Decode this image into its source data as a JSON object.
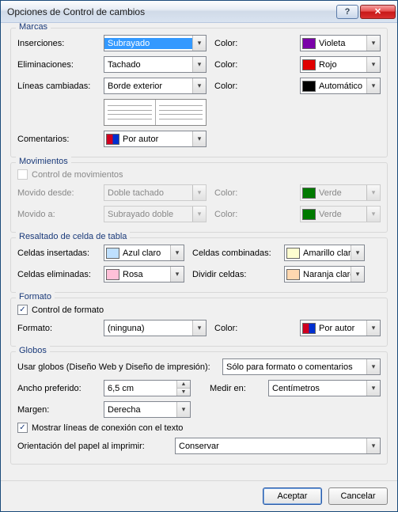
{
  "window": {
    "title": "Opciones de Control de cambios"
  },
  "groups": {
    "marcas": "Marcas",
    "movimientos": "Movimientos",
    "tabla": "Resaltado de celda de tabla",
    "formato": "Formato",
    "globos": "Globos"
  },
  "marcas": {
    "inserciones": {
      "label": "Inserciones:",
      "value": "Subrayado",
      "color_label": "Color:",
      "color_value": "Violeta",
      "color": "#7a00a8"
    },
    "eliminaciones": {
      "label": "Eliminaciones:",
      "value": "Tachado",
      "color_label": "Color:",
      "color_value": "Rojo",
      "color": "#e00000"
    },
    "lineas": {
      "label": "Líneas cambiadas:",
      "value": "Borde exterior",
      "color_label": "Color:",
      "color_value": "Automático",
      "color": "#000000"
    },
    "comentarios": {
      "label": "Comentarios:",
      "value": "Por autor"
    }
  },
  "movimientos": {
    "control": "Control de movimientos",
    "desde": {
      "label": "Movido desde:",
      "value": "Doble tachado",
      "color_label": "Color:",
      "color_value": "Verde",
      "color": "#007a00"
    },
    "a": {
      "label": "Movido a:",
      "value": "Subrayado doble",
      "color_label": "Color:",
      "color_value": "Verde",
      "color": "#007a00"
    }
  },
  "tabla": {
    "insertadas": {
      "label": "Celdas insertadas:",
      "value": "Azul claro",
      "color": "#bfe0ff"
    },
    "eliminadas": {
      "label": "Celdas eliminadas:",
      "value": "Rosa",
      "color": "#ffc0d8"
    },
    "combinadas": {
      "label": "Celdas combinadas:",
      "value": "Amarillo claro",
      "color": "#fdfdd0"
    },
    "dividir": {
      "label": "Dividir celdas:",
      "value": "Naranja claro",
      "color": "#ffd8b0"
    }
  },
  "formato": {
    "control": "Control de formato",
    "formato": {
      "label": "Formato:",
      "value": "(ninguna)",
      "color_label": "Color:",
      "color_value": "Por autor"
    }
  },
  "globos": {
    "usar": {
      "label": "Usar globos (Diseño Web y Diseño de impresión):",
      "value": "Sólo para formato o comentarios"
    },
    "ancho": {
      "label": "Ancho preferido:",
      "value": "6,5 cm"
    },
    "medir": {
      "label": "Medir en:",
      "value": "Centímetros"
    },
    "margen": {
      "label": "Margen:",
      "value": "Derecha"
    },
    "mostrar": "Mostrar líneas de conexión con el texto",
    "orientacion": {
      "label": "Orientación del papel al imprimir:",
      "value": "Conservar"
    }
  },
  "buttons": {
    "ok": "Aceptar",
    "cancel": "Cancelar"
  }
}
